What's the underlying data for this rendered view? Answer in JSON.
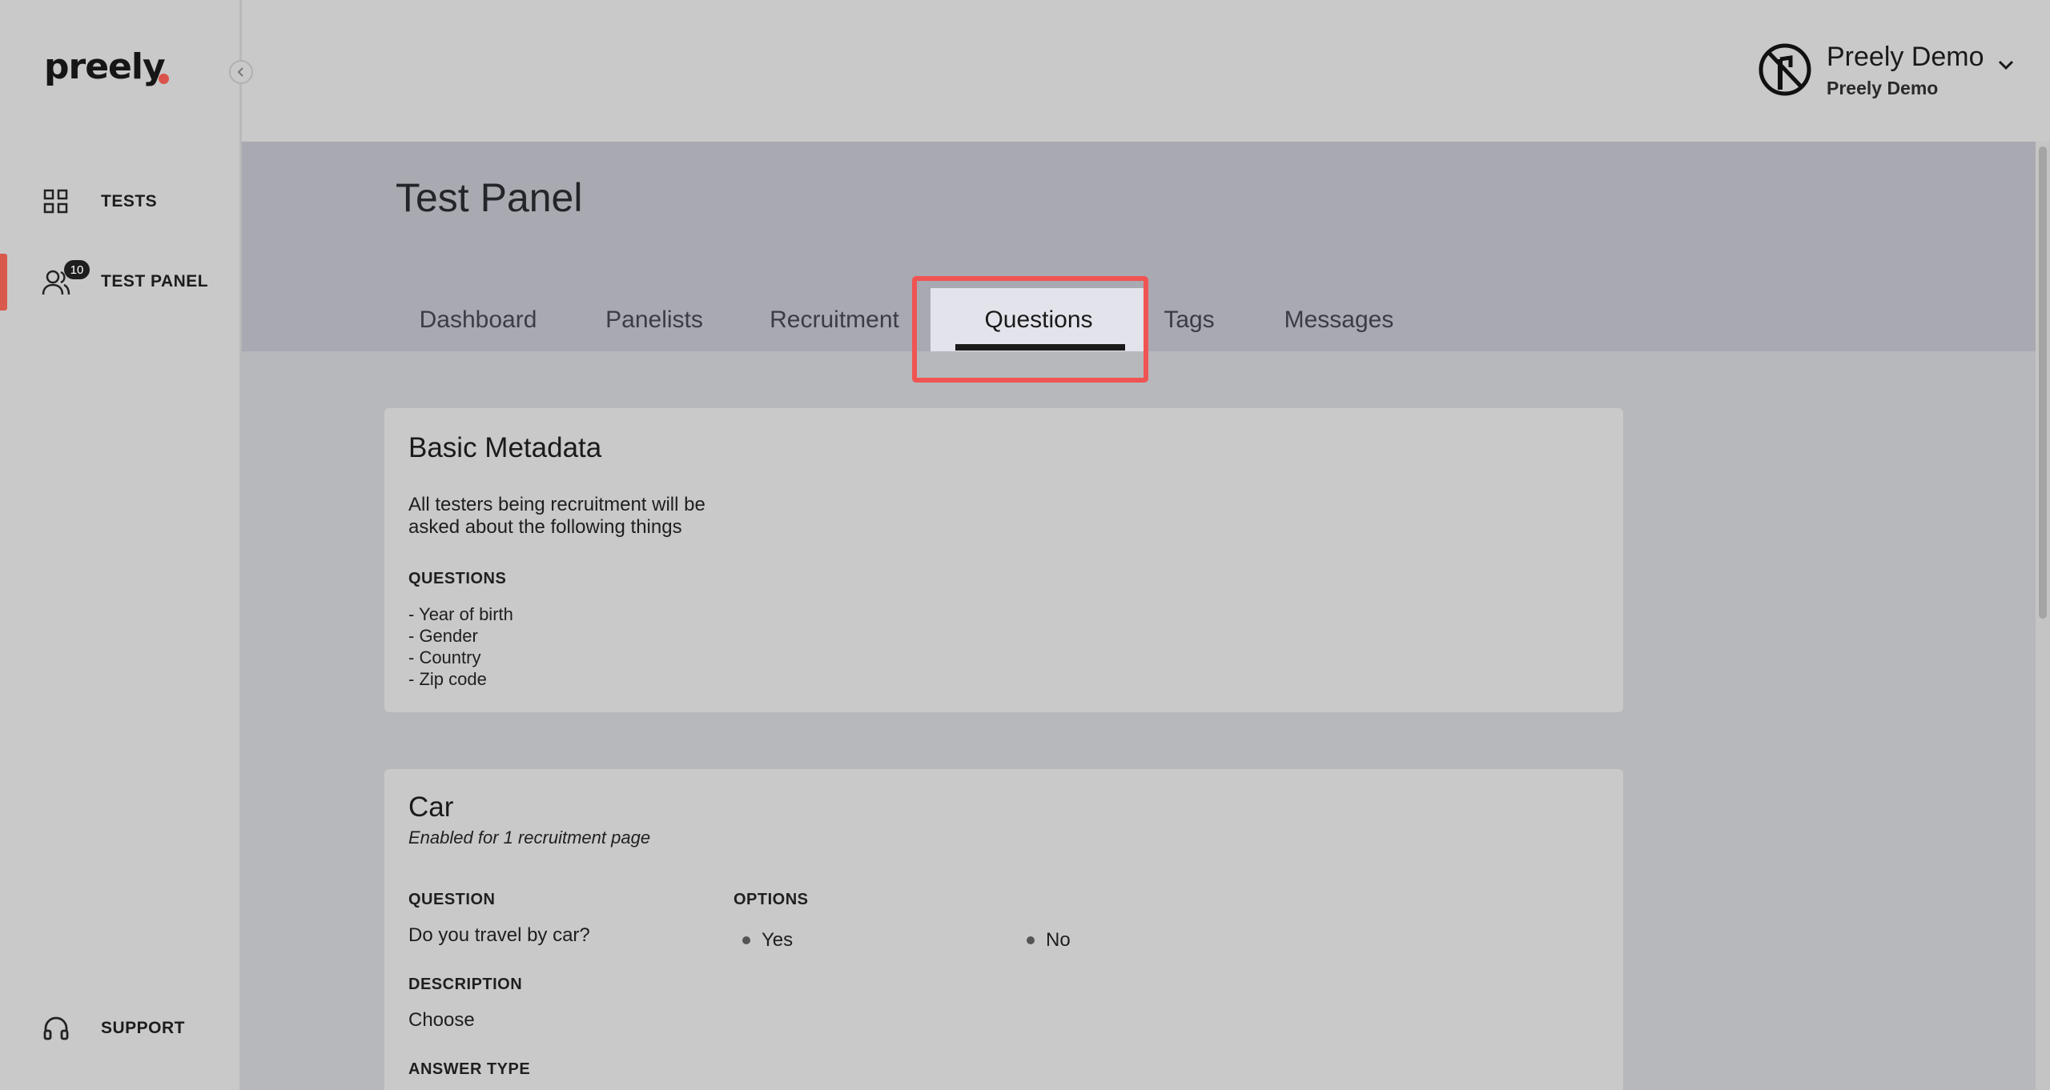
{
  "app": {
    "logo": "preely"
  },
  "sidebar": {
    "items": [
      {
        "label": "TESTS",
        "icon": "grid-icon"
      },
      {
        "label": "TEST PANEL",
        "icon": "users-icon",
        "badge": "10",
        "active": true
      }
    ],
    "support": {
      "label": "SUPPORT",
      "icon": "headset-icon"
    }
  },
  "user": {
    "name": "Preely Demo",
    "org": "Preely Demo"
  },
  "page": {
    "title": "Test Panel"
  },
  "tabs": [
    "Dashboard",
    "Panelists",
    "Recruitment",
    "Questions",
    "Tags",
    "Messages"
  ],
  "active_tab": "Questions",
  "basic_metadata": {
    "title": "Basic Metadata",
    "description": "All testers being recruitment will be asked about the following things",
    "questions_label": "QUESTIONS",
    "questions": [
      "- Year of birth",
      "- Gender",
      "- Country",
      "- Zip code"
    ]
  },
  "car": {
    "title": "Car",
    "subtitle": "Enabled for 1 recruitment page",
    "question_label": "QUESTION",
    "question": "Do you travel by car?",
    "options_label": "OPTIONS",
    "options": [
      "Yes",
      "No"
    ],
    "description_label": "DESCRIPTION",
    "description": "Choose",
    "answer_type_label": "ANSWER TYPE"
  },
  "colors": {
    "accent": "#d95a4c",
    "highlight": "#f05452"
  }
}
